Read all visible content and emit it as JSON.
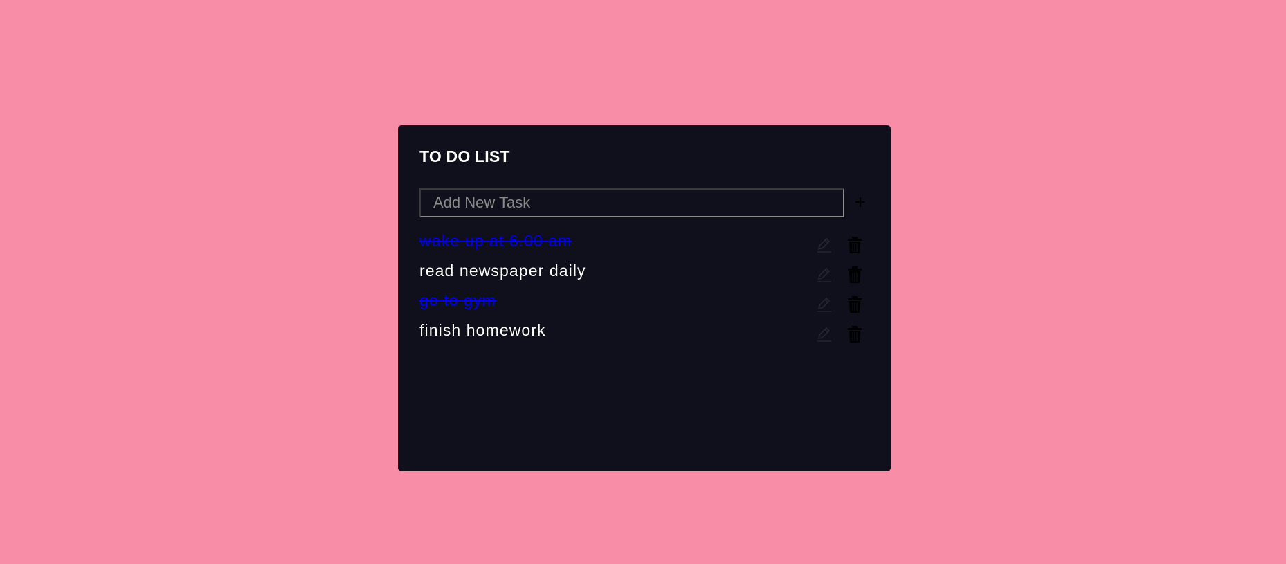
{
  "app": {
    "title": "TO DO LIST"
  },
  "input": {
    "placeholder": "Add New Task",
    "value": ""
  },
  "add_button": {
    "icon": "plus-icon"
  },
  "tasks": [
    {
      "text": "wake up at 6.00 am",
      "completed": true
    },
    {
      "text": "read newspaper daily",
      "completed": false
    },
    {
      "text": "go to gym",
      "completed": true
    },
    {
      "text": "finish homework",
      "completed": false
    }
  ],
  "task_actions": {
    "edit_icon": "pencil-icon",
    "delete_icon": "trash-icon"
  },
  "colors": {
    "page_background": "#f78da7",
    "card_background": "#10101c",
    "completed_task": "#0000ee",
    "active_task": "#ffffff"
  }
}
